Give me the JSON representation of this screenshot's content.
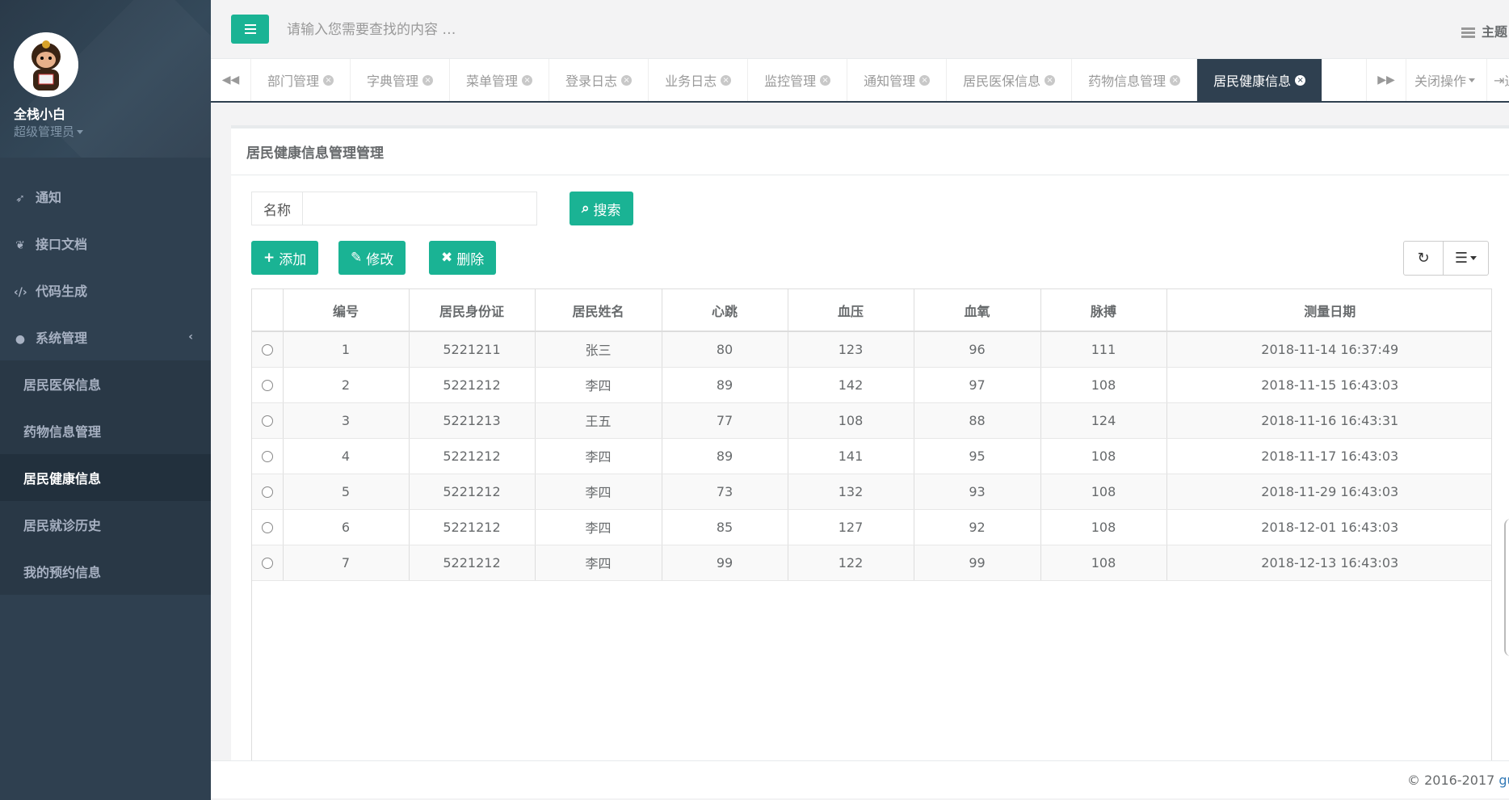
{
  "user": {
    "name": "全栈小白",
    "role": "超级管理员"
  },
  "sidebar": {
    "items": [
      {
        "label": "通知",
        "icon": "rocket-icon"
      },
      {
        "label": "接口文档",
        "icon": "leaf-icon"
      },
      {
        "label": "代码生成",
        "icon": "code-icon"
      },
      {
        "label": "系统管理",
        "icon": "user-icon"
      }
    ],
    "subitems": [
      {
        "label": "居民医保信息"
      },
      {
        "label": "药物信息管理"
      },
      {
        "label": "居民健康信息"
      },
      {
        "label": "居民就诊历史"
      },
      {
        "label": "我的预约信息"
      }
    ]
  },
  "topbar": {
    "search_placeholder": "请输入您需要查找的内容 …",
    "theme_label": "主题"
  },
  "tabs": [
    {
      "label": "部门管理"
    },
    {
      "label": "字典管理"
    },
    {
      "label": "菜单管理"
    },
    {
      "label": "登录日志"
    },
    {
      "label": "业务日志"
    },
    {
      "label": "监控管理"
    },
    {
      "label": "通知管理"
    },
    {
      "label": "居民医保信息"
    },
    {
      "label": "药物信息管理"
    },
    {
      "label": "居民健康信息"
    }
  ],
  "tab_actions": {
    "close_ops": "关闭操作",
    "exit": "退"
  },
  "panel": {
    "title": "居民健康信息管理管理",
    "name_label": "名称",
    "search_btn": "搜索",
    "add_btn": "添加",
    "edit_btn": "修改",
    "delete_btn": "删除"
  },
  "table": {
    "headers": [
      "编号",
      "居民身份证",
      "居民姓名",
      "心跳",
      "血压",
      "血氧",
      "脉搏",
      "测量日期"
    ],
    "rows": [
      [
        "1",
        "5221211",
        "张三",
        "80",
        "123",
        "96",
        "111",
        "2018-11-14 16:37:49"
      ],
      [
        "2",
        "5221212",
        "李四",
        "89",
        "142",
        "97",
        "108",
        "2018-11-15 16:43:03"
      ],
      [
        "3",
        "5221213",
        "王五",
        "77",
        "108",
        "88",
        "124",
        "2018-11-16 16:43:31"
      ],
      [
        "4",
        "5221212",
        "李四",
        "89",
        "141",
        "95",
        "108",
        "2018-11-17 16:43:03"
      ],
      [
        "5",
        "5221212",
        "李四",
        "73",
        "132",
        "93",
        "108",
        "2018-11-29 16:43:03"
      ],
      [
        "6",
        "5221212",
        "李四",
        "85",
        "127",
        "92",
        "108",
        "2018-12-01 16:43:03"
      ],
      [
        "7",
        "5221212",
        "李四",
        "99",
        "122",
        "99",
        "108",
        "2018-12-13 16:43:03"
      ]
    ]
  },
  "footer": {
    "copyright": "© 2016-2017 ",
    "link": "gun"
  },
  "colors": {
    "primary": "#1ab394",
    "sidebar": "#2f4050",
    "active_tab": "#2f4050"
  }
}
